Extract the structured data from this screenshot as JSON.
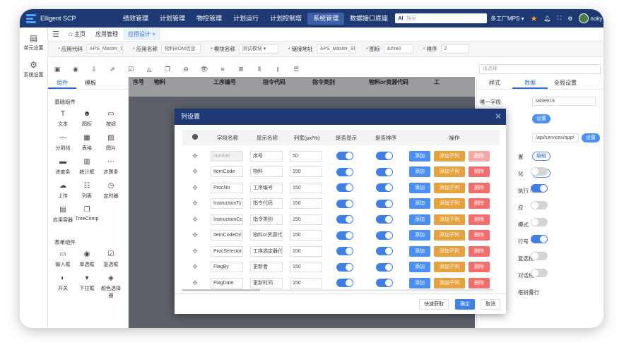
{
  "app": {
    "title": "Elligent SCP"
  },
  "nav": [
    "绩效管理",
    "计划管理",
    "物控管理",
    "计划运行",
    "计划控制塔",
    "系统管理",
    "数据接口底座"
  ],
  "nav_active": 5,
  "search": {
    "placeholder": "搜索",
    "badge": "AI"
  },
  "topright": {
    "factory": "多工厂MPS ▾",
    "user": "noky"
  },
  "leftbar": [
    {
      "label": "单元设置"
    },
    {
      "label": "系统设置"
    }
  ],
  "tabs": [
    "主页",
    "应用管理",
    "应用设计 ×"
  ],
  "props": [
    {
      "label": "应用代码",
      "value": "APS_Master_Sl"
    },
    {
      "label": "应用名称",
      "value": "物料BOM信息"
    },
    {
      "label": "模块名称",
      "value": "测试模块 ▾"
    },
    {
      "label": "链接地址",
      "value": "APS_Master_Sl"
    },
    {
      "label": "图标",
      "value": "&#xe6"
    },
    {
      "label": "排序",
      "value": "2"
    }
  ],
  "select_placeholder": "请选择",
  "comp_tabs": [
    "组件",
    "模板"
  ],
  "groups": [
    {
      "title": "基础组件",
      "items": [
        "文本",
        "图标",
        "按钮",
        "分割线",
        "表格",
        "图片",
        "进度条",
        "统计框",
        "步骤条",
        "上传",
        "列表",
        "定时器",
        "应用容器",
        "TreeComp"
      ]
    },
    {
      "title": "表单组件",
      "items": [
        "输入框",
        "单选框",
        "复选框",
        "开关",
        "下拉框",
        "颜色选择器"
      ]
    }
  ],
  "canvas_headers": [
    "序号",
    "物料",
    "工序编号",
    "指令代码",
    "指令类别",
    "物料or资源代码",
    "工"
  ],
  "rpanel": {
    "tabs": [
      "样式",
      "数据",
      "全局设置"
    ],
    "unique_label": "唯一字段",
    "unique_value": "table913",
    "set1": "设置",
    "api": "/api/services/app/",
    "set2": "设置",
    "labels": [
      "置",
      "化",
      "执行 ⓘ",
      "应",
      "模式",
      "行号",
      "复选框",
      "对话框",
      "框树叠行"
    ],
    "edit": "编辑"
  },
  "dialog": {
    "title": "列设置",
    "headers": [
      "字段名称",
      "显示名称",
      "列宽(px/%)",
      "是否显示",
      "是否排序",
      "操作"
    ],
    "rows": [
      {
        "field": "number",
        "display": "序号",
        "width": "50"
      },
      {
        "field": "ItemCode",
        "display": "物料",
        "width": "150"
      },
      {
        "field": "ProcNo",
        "display": "工序编号",
        "width": "150"
      },
      {
        "field": "InstructionTy",
        "display": "指令代码",
        "width": "150"
      },
      {
        "field": "InstructionCc",
        "display": "指令类别",
        "width": "150"
      },
      {
        "field": "ItemCodeOrl",
        "display": "物料or资源代",
        "width": "150"
      },
      {
        "field": "ProcSelector",
        "display": "工序选定器代",
        "width": "150"
      },
      {
        "field": "FlagBy",
        "display": "更新者",
        "width": "150"
      },
      {
        "field": "FlagDate",
        "display": "更新时间",
        "width": "150"
      }
    ],
    "btn_add": "添加",
    "btn_sub": "添加子列",
    "btn_del": "删除",
    "foot": [
      "快速获取",
      "确定",
      "取消"
    ]
  }
}
